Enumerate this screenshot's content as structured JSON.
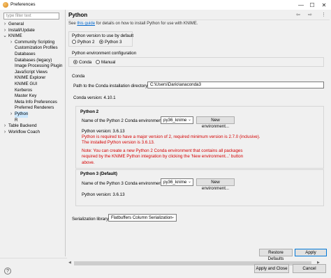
{
  "window": {
    "title": "Preferences",
    "minimize": "—",
    "maximize": "☐",
    "close": "✕"
  },
  "filter": {
    "placeholder": "type filter text"
  },
  "tree": [
    {
      "label": "General",
      "arrow": ">",
      "indent": 0
    },
    {
      "label": "Install/Update",
      "arrow": ">",
      "indent": 0
    },
    {
      "label": "KNIME",
      "arrow": "v",
      "indent": 0
    },
    {
      "label": "Community Scripting",
      "arrow": ">",
      "indent": 1
    },
    {
      "label": "Customization Profiles",
      "arrow": "",
      "indent": 1
    },
    {
      "label": "Databases",
      "arrow": "",
      "indent": 1
    },
    {
      "label": "Databases (legacy)",
      "arrow": "",
      "indent": 1
    },
    {
      "label": "Image Processing Plugin",
      "arrow": "",
      "indent": 1
    },
    {
      "label": "JavaScript Views",
      "arrow": "",
      "indent": 1
    },
    {
      "label": "KNIME Explorer",
      "arrow": "",
      "indent": 1
    },
    {
      "label": "KNIME GUI",
      "arrow": "",
      "indent": 1
    },
    {
      "label": "Kerberos",
      "arrow": "",
      "indent": 1
    },
    {
      "label": "Master Key",
      "arrow": "",
      "indent": 1
    },
    {
      "label": "Meta Info Preferences",
      "arrow": "",
      "indent": 1
    },
    {
      "label": "Preferred Renderers",
      "arrow": "",
      "indent": 1
    },
    {
      "label": "Python",
      "arrow": ">",
      "indent": 1,
      "selected": true
    },
    {
      "label": "R",
      "arrow": "",
      "indent": 1
    },
    {
      "label": "Table Backend",
      "arrow": ">",
      "indent": 0
    },
    {
      "label": "Workflow Coach",
      "arrow": ">",
      "indent": 0
    }
  ],
  "panel": {
    "title": "Python",
    "nav": {
      "back": "⇦",
      "forward": "⇨",
      "menu": "⋮"
    },
    "hint_pre": "See ",
    "hint_link": "this guide",
    "hint_post": " for details on how to install Python for use with KNIME.",
    "version_group": {
      "label": "Python version to use by default",
      "options": [
        "Python 2",
        "Python 3"
      ],
      "selected": "Python 3"
    },
    "env_config": {
      "label": "Python environment configuration",
      "options": [
        "Conda",
        "Manual"
      ],
      "selected": "Conda"
    },
    "conda": {
      "heading": "Conda",
      "dir_label": "Path to the Conda installation directory",
      "dir_value": "C:\\Users\\Dario\\anaconda3",
      "version": "Conda version: 4.10.1"
    },
    "py2": {
      "heading": "Python 2",
      "env_label": "Name of the Python 2 Conda environment",
      "env_value": "py36_knime",
      "new_env": "New environment...",
      "version": "Python version: 3.6.13",
      "error1": "Python is required to have a major version of 2, required minimum version is 2.7.0 (inclusive).",
      "error2": "The installed Python version is 3.6.13.",
      "note1": "Note: You can create a new Python 2 Conda environment that contains all packages",
      "note2": "required by the KNIME Python integration by clicking the 'New environment...' button",
      "note3": "above."
    },
    "py3": {
      "heading": "Python 3 (Default)",
      "env_label": "Name of the Python 3 Conda environment",
      "env_value": "py36_knime",
      "new_env": "New environment...",
      "version": "Python version: 3.6.13"
    },
    "serialization": {
      "label": "Serialization library",
      "value": "Flatbuffers Column Serialization"
    },
    "restore": "Restore Defaults",
    "apply": "Apply"
  },
  "footer": {
    "help": "?",
    "apply_close": "Apply and Close",
    "cancel": "Cancel"
  }
}
